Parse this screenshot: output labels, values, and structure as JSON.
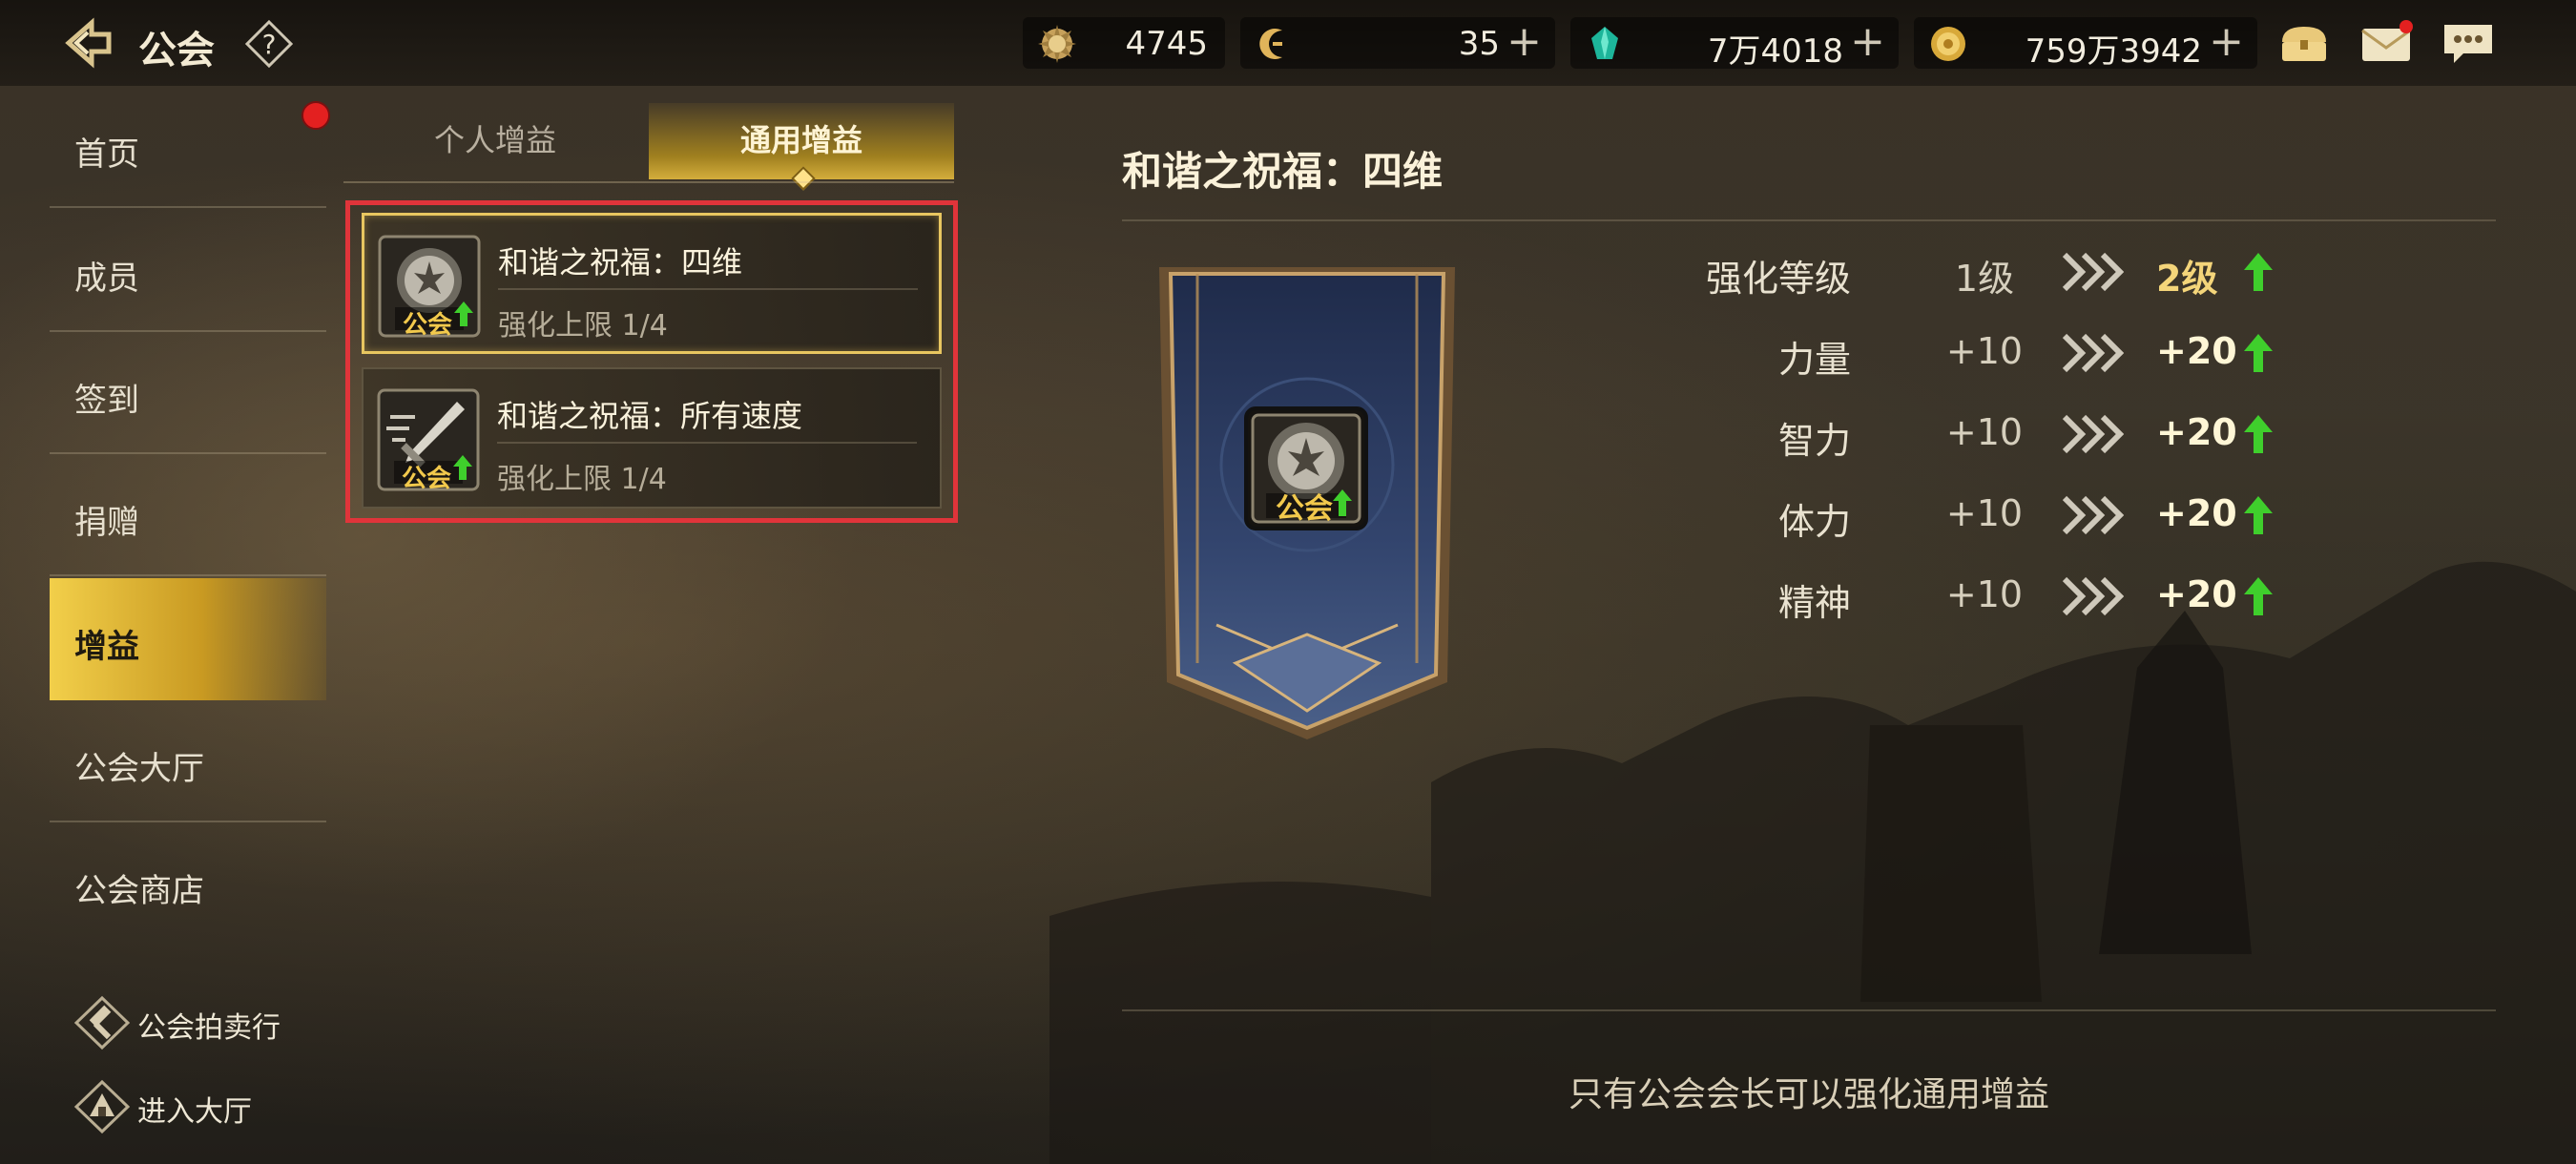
{
  "header": {
    "title": "公会",
    "back_icon": "back-arrow-icon",
    "help_icon": "question-icon"
  },
  "resources": [
    {
      "name": "guild-contribution",
      "icon": "sun-medal-icon",
      "value": "4745",
      "has_plus": false
    },
    {
      "name": "crescent-currency",
      "icon": "crescent-coin-icon",
      "value": "35",
      "has_plus": true
    },
    {
      "name": "diamond",
      "icon": "teal-gem-icon",
      "value": "7万4018",
      "has_plus": true
    },
    {
      "name": "gold",
      "icon": "gold-coin-icon",
      "value": "759万3942",
      "has_plus": true
    }
  ],
  "top_icons": [
    "treasure-chest-icon",
    "mail-icon",
    "chat-icon"
  ],
  "sidebar": {
    "items": [
      {
        "label": "首页",
        "active": false,
        "badge": true
      },
      {
        "label": "成员",
        "active": false
      },
      {
        "label": "签到",
        "active": false
      },
      {
        "label": "捐赠",
        "active": false
      },
      {
        "label": "增益",
        "active": true
      },
      {
        "label": "公会大厅",
        "active": false
      },
      {
        "label": "公会商店",
        "active": false
      }
    ],
    "extras": [
      {
        "label": "公会拍卖行",
        "icon": "gavel-icon"
      },
      {
        "label": "进入大厅",
        "icon": "hall-icon"
      }
    ]
  },
  "tabs": {
    "personal": "个人增益",
    "general": "通用增益",
    "active": "general"
  },
  "buffs": [
    {
      "title": "和谐之祝福：四维",
      "limit": "强化上限 1/4",
      "icon": "guild-emblem-icon",
      "icon_badge": "公会",
      "selected": true
    },
    {
      "title": "和谐之祝福：所有速度",
      "limit": "强化上限 1/4",
      "icon": "sword-speed-icon",
      "icon_badge": "公会",
      "selected": false
    }
  ],
  "detail": {
    "title": "和谐之祝福：四维",
    "banner_icon_badge": "公会",
    "rows": [
      {
        "name": "强化等级",
        "current": "1级",
        "next": "2级"
      },
      {
        "name": "力量",
        "current": "+10",
        "next": "+20"
      },
      {
        "name": "智力",
        "current": "+10",
        "next": "+20"
      },
      {
        "name": "体力",
        "current": "+10",
        "next": "+20"
      },
      {
        "name": "精神",
        "current": "+10",
        "next": "+20"
      }
    ],
    "notice": "只有公会会长可以强化通用增益"
  },
  "colors": {
    "accent_gold": "#e8c660",
    "highlight_red": "#e0343a",
    "up_arrow_green": "#3fcf2c",
    "notification_red": "#e32020"
  }
}
